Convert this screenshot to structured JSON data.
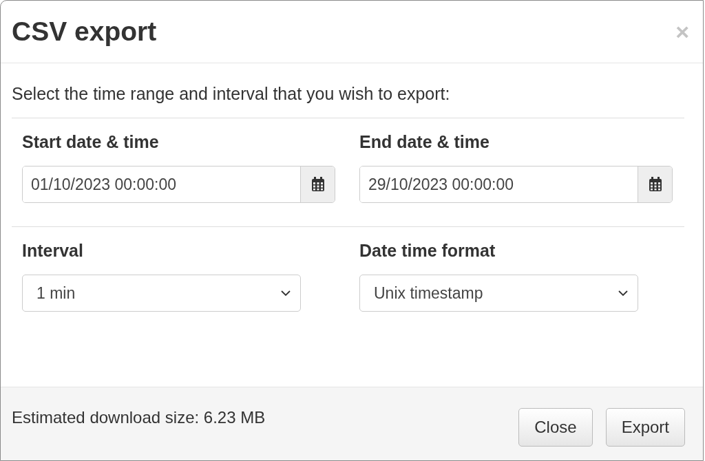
{
  "dialog": {
    "title": "CSV export",
    "close_glyph": "×",
    "instructions": "Select the time range and interval that you wish to export:",
    "date_fields": [
      {
        "label": "Start date & time",
        "value": "01/10/2023 00:00:00"
      },
      {
        "label": "End date & time",
        "value": "29/10/2023 00:00:00"
      }
    ],
    "select_fields": [
      {
        "label": "Interval",
        "value": "1 min"
      },
      {
        "label": "Date time format",
        "value": "Unix timestamp"
      }
    ],
    "footer": {
      "estimate": "Estimated download size: 6.23 MB",
      "buttons": [
        "Close",
        "Export"
      ]
    }
  }
}
